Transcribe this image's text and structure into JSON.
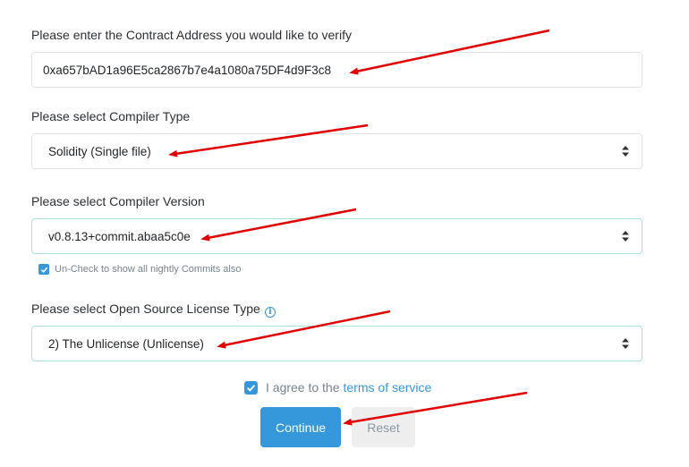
{
  "contract_address": {
    "label": "Please enter the Contract Address you would like to verify",
    "value": "0xa657bAD1a96E5ca2867b7e4a1080a75DF4d9F3c8"
  },
  "compiler_type": {
    "label": "Please select Compiler Type",
    "value": "Solidity (Single file)"
  },
  "compiler_version": {
    "label": "Please select Compiler Version",
    "value": "v0.8.13+commit.abaa5c0e",
    "nightly_text": "Un-Check to show all nightly Commits also",
    "nightly_checked": true
  },
  "license_type": {
    "label": "Please select Open Source License Type",
    "value": "2) The Unlicense (Unlicense)"
  },
  "agreement": {
    "text": "I agree to the",
    "link_text": "terms of service",
    "checked": true
  },
  "buttons": {
    "continue": "Continue",
    "reset": "Reset"
  },
  "colors": {
    "accent": "#3498db",
    "annotation_arrow": "#e00000",
    "focus_border": "#a9e2d9"
  }
}
